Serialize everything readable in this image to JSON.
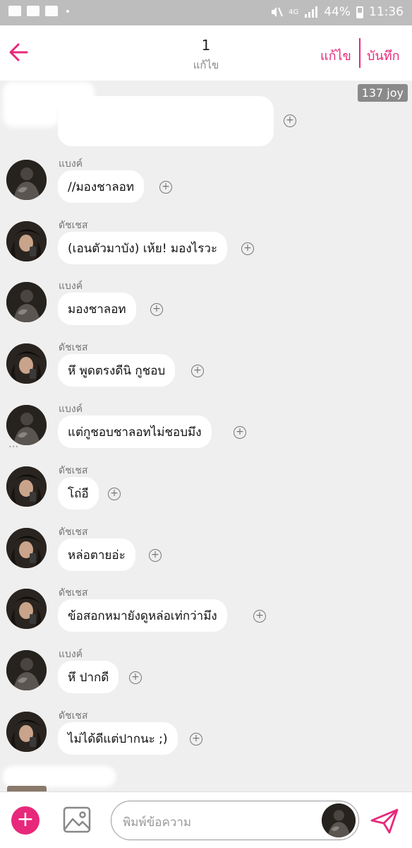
{
  "status_bar": {
    "network": "4G",
    "battery": "44%",
    "time": "11:36",
    "icons": [
      "gallery-icon",
      "message-icon",
      "folder-icon",
      "mute-icon",
      "signal-icon",
      "battery-icon"
    ]
  },
  "header": {
    "title": "1",
    "subtitle": "แก้ไข",
    "edit_label": "แก้ไข",
    "save_label": "บันทึก",
    "accent_color": "#e8287a"
  },
  "chat": {
    "view_count": "137 joy",
    "messages": [
      {
        "sender": "แบงค์",
        "text": "//มองชาลอท",
        "avatar": "avatar-bank"
      },
      {
        "sender": "ดัชเชส",
        "text": "(เอนตัวมาบัง) เห้ย! มองไรวะ",
        "avatar": "avatar-duchess"
      },
      {
        "sender": "แบงค์",
        "text": "มองชาลอท",
        "avatar": "avatar-bank"
      },
      {
        "sender": "ดัชเชส",
        "text": "หึ พูดตรงดีนิ กูชอบ",
        "avatar": "avatar-duchess"
      },
      {
        "sender": "แบงค์",
        "text": "แต่กูชอบชาลอทไม่ชอบมึง",
        "avatar": "avatar-bank"
      },
      {
        "sender": "ดัชเชส",
        "text": "โถ่อี",
        "avatar": "avatar-duchess"
      },
      {
        "sender": "ดัชเชส",
        "text": "หล่อตายอ่ะ",
        "avatar": "avatar-duchess"
      },
      {
        "sender": "ดัชเชส",
        "text": "ข้อสอกหมายังดูหล่อเท่กว่ามึง",
        "avatar": "avatar-duchess"
      },
      {
        "sender": "แบงค์",
        "text": "หึ ปากดี",
        "avatar": "avatar-bank"
      },
      {
        "sender": "ดัชเชส",
        "text": "ไม่ได้ดีแต่ปากนะ ;)",
        "avatar": "avatar-duchess"
      }
    ]
  },
  "composer": {
    "placeholder": "พิมพ์ข้อความ"
  }
}
